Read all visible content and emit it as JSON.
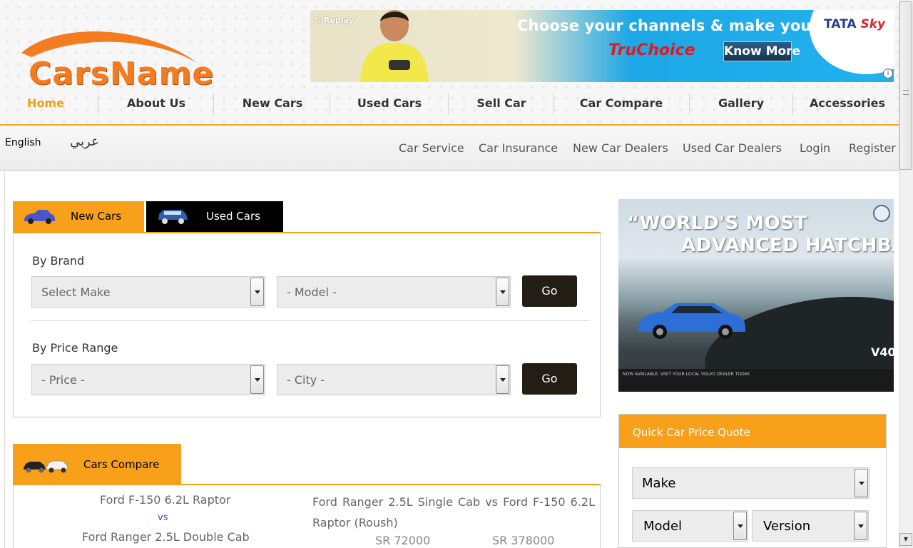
{
  "site": {
    "logo_text": "CarsName"
  },
  "banner": {
    "replay": "Replay",
    "headline": "Choose your channels & make your package!",
    "product_a": "Tru",
    "product_b": "Choice",
    "cta": "Know More",
    "brand_a": "TATA",
    "brand_b": "Sky",
    "info": "i"
  },
  "nav": {
    "items": [
      {
        "label": "Home",
        "active": true
      },
      {
        "label": "About Us"
      },
      {
        "label": "New Cars"
      },
      {
        "label": "Used Cars"
      },
      {
        "label": "Sell Car"
      },
      {
        "label": "Car Compare"
      },
      {
        "label": "Gallery"
      },
      {
        "label": "Accessories"
      }
    ]
  },
  "subbar": {
    "lang_en": "English",
    "lang_ar": "عربي",
    "links": [
      "Car Service",
      "Car Insurance",
      "New Car Dealers",
      "Used Car Dealers",
      "Login",
      "Register"
    ]
  },
  "search": {
    "tab_new": "New Cars",
    "tab_used": "Used Cars",
    "by_brand": "By Brand",
    "make_value": "Select Make",
    "model_value": "- Model -",
    "go": "Go",
    "by_price": "By Price Range",
    "price_value": "- Price -",
    "city_value": "- City -"
  },
  "compare": {
    "tab": "Cars Compare",
    "left_a": "Ford F-150 6.2L Raptor",
    "vs": "vs",
    "left_b": "Ford Ranger 2.5L Double Cab",
    "right_text": "Ford Ranger 2.5L Single Cab vs Ford F-150 6.2L Raptor (Roush)",
    "price_a": "SR 72000",
    "price_b": "SR 378000"
  },
  "ad": {
    "quote_line1": "“WORLD'S MOST",
    "quote_line2": "ADVANCED HATCHBACK”",
    "model": "V40",
    "strip": "NOW AVAILABLE. VISIT YOUR LOCAL VOLVO DEALER TODAY."
  },
  "quote": {
    "title": "Quick Car Price Quote",
    "make": "Make",
    "model": "Model",
    "version": "Version"
  },
  "colors": {
    "accent": "#f9a01b",
    "nav_active": "#f49c13",
    "dark_button": "#231d15",
    "link_blue": "#2a52be"
  }
}
